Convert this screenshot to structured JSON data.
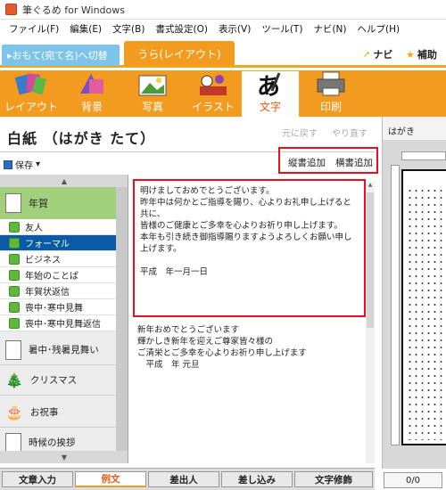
{
  "window": {
    "title": "筆ぐるめ for Windows"
  },
  "menu": [
    "ファイル(F)",
    "編集(E)",
    "文字(B)",
    "書式設定(O)",
    "表示(V)",
    "ツール(T)",
    "ナビ(N)",
    "ヘルプ(H)"
  ],
  "mode": {
    "omote_label": "▸おもて(宛て名)へ切替",
    "ura_label": "うら(レイアウト)",
    "navi": "ナビ",
    "help": "補助"
  },
  "toolbar": [
    {
      "label": "レイアウト",
      "icon": "layout-icon"
    },
    {
      "label": "背景",
      "icon": "background-icon"
    },
    {
      "label": "写真",
      "icon": "photo-icon"
    },
    {
      "label": "イラスト",
      "icon": "illustration-icon"
    },
    {
      "label": "文字",
      "icon": "text-icon",
      "active": true
    },
    {
      "label": "印刷",
      "icon": "printer-icon"
    }
  ],
  "heading": {
    "title": "白紙 （はがき たて）",
    "undo": "元に戻す",
    "redo": "やり直す"
  },
  "preview": {
    "label": "はがき",
    "page": "0/0"
  },
  "actions": {
    "save": "保存",
    "add_vertical": "縦書追加",
    "add_horizontal": "横書追加"
  },
  "categories": {
    "current": "年賀",
    "subitems": [
      "友人",
      "フォーマル",
      "ビジネス",
      "年始のことば",
      "年賀状返信",
      "喪中･寒中見舞",
      "喪中･寒中見舞返信"
    ],
    "selected_index": 1,
    "others": [
      "暑中･残暑見舞い",
      "クリスマス",
      "お祝事",
      "時候の挨拶"
    ]
  },
  "texts": {
    "selected": "明けましておめでとうございます。\n昨年中は何かとご指導を賜り、心よりお礼申し上げると共に、\n皆様のご健康とご多幸を心よりお祈り申し上げます。\n本年も引き続き御指導賜りますようよろしくお願い申し上げます。\n\n平成　年一月一日",
    "next": "新年おめでとうございます\n輝かしき新年を迎えご尊家皆々様の\nご清栄とご多幸を心よりお祈り申し上げます\n　平成　年 元旦"
  },
  "bottom_tabs": [
    "文章入力",
    "例文",
    "差出人",
    "差し込み",
    "文字修飾"
  ],
  "colors": {
    "accent": "#f29b1e",
    "selection": "#0b5aa6",
    "highlight_border": "#e8101e",
    "category_green": "#a2cf7c"
  }
}
